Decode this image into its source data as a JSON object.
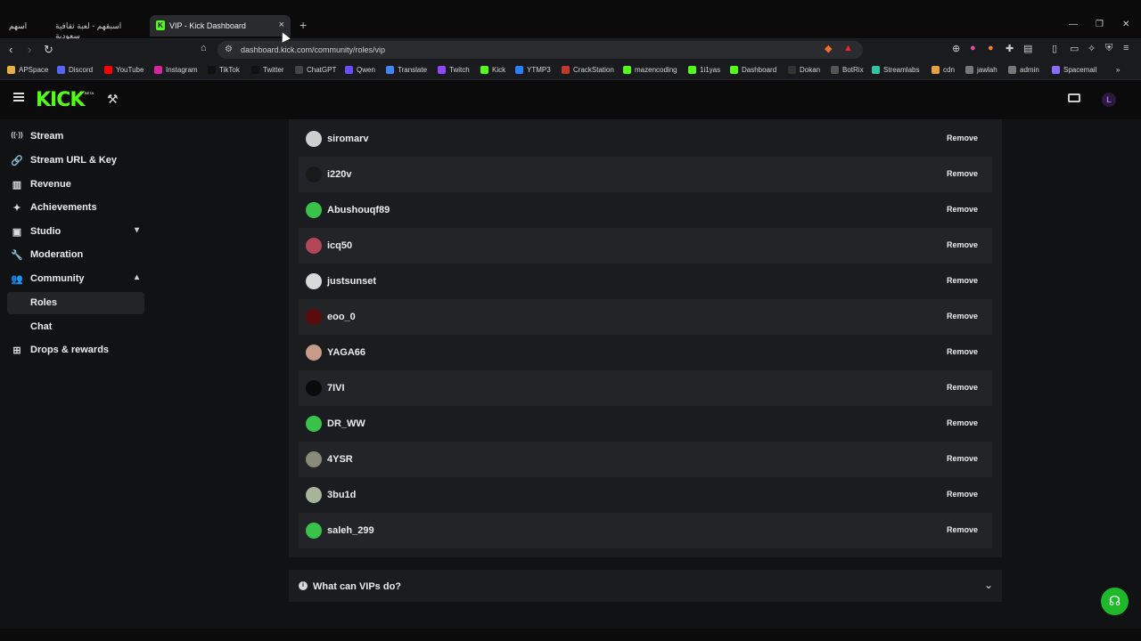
{
  "browser": {
    "tabs": [
      {
        "label": "اسبقهم - لعبة ثقافية سعودية",
        "icon_text": "اسهم"
      },
      {
        "label": "VIP - Kick Dashboard",
        "active": true
      }
    ],
    "new_tab": "+",
    "url": "dashboard.kick.com/community/roles/vip",
    "window_controls": [
      "—",
      "❐",
      "✕"
    ],
    "bookmarks": [
      {
        "label": "APSpace",
        "color": "#e8b040"
      },
      {
        "label": "Discord",
        "color": "#5865f2"
      },
      {
        "label": "YouTube",
        "color": "#ff0000"
      },
      {
        "label": "Instagram",
        "color": "#d6249f"
      },
      {
        "label": "TikTok",
        "color": "#111111"
      },
      {
        "label": "Twitter",
        "color": "#111111"
      },
      {
        "label": "ChatGPT",
        "color": "#444444"
      },
      {
        "label": "Qwen",
        "color": "#6b4cff"
      },
      {
        "label": "Translate",
        "color": "#4285f4"
      },
      {
        "label": "Twitch",
        "color": "#9146ff"
      },
      {
        "label": "Kick",
        "color": "#53fc18"
      },
      {
        "label": "YTMP3",
        "color": "#2a7fff"
      },
      {
        "label": "CrackStation",
        "color": "#c0392b"
      },
      {
        "label": "mazencoding",
        "color": "#53fc18"
      },
      {
        "label": "1i1yas",
        "color": "#53fc18"
      },
      {
        "label": "Dashboard",
        "color": "#53fc18"
      },
      {
        "label": "Dokan",
        "color": "#333333"
      },
      {
        "label": "BotRix",
        "color": "#555555"
      },
      {
        "label": "Streamlabs",
        "color": "#31c3a2"
      },
      {
        "label": "cdn",
        "color": "#e8a040"
      },
      {
        "label": "jawlah",
        "color": "#777777"
      },
      {
        "label": "admin",
        "color": "#777777"
      },
      {
        "label": "Spacemail",
        "color": "#8a6cff"
      }
    ]
  },
  "header": {
    "logo": "KICK",
    "beta": "BETA",
    "avatar_letter": "L"
  },
  "sidebar": {
    "items": [
      {
        "label": "Stream",
        "icon": "radio-icon",
        "glyph": "((·))"
      },
      {
        "label": "Stream URL & Key",
        "icon": "link-icon",
        "glyph": "🔗"
      },
      {
        "label": "Revenue",
        "icon": "chart-icon",
        "glyph": "▥"
      },
      {
        "label": "Achievements",
        "icon": "trophy-icon",
        "glyph": "✦"
      },
      {
        "label": "Studio",
        "icon": "studio-icon",
        "glyph": "▣",
        "chevron": "▾"
      },
      {
        "label": "Moderation",
        "icon": "wrench-icon",
        "glyph": "🔧"
      },
      {
        "label": "Community",
        "icon": "community-icon",
        "glyph": "👥",
        "chevron": "▴"
      },
      {
        "label": "Drops & rewards",
        "icon": "drops-icon",
        "glyph": "⊞"
      }
    ],
    "sub_items": [
      {
        "label": "Roles",
        "active": true
      },
      {
        "label": "Chat",
        "active": false
      }
    ]
  },
  "vip_list": {
    "remove_label": "Remove",
    "users": [
      {
        "name": "siromarv",
        "avatar_color": "#cfcfcf"
      },
      {
        "name": "i220v",
        "avatar_color": "#1a1a1a"
      },
      {
        "name": "Abushouqf89",
        "avatar_color": "#3ac14a"
      },
      {
        "name": "icq50",
        "avatar_color": "#b2475a"
      },
      {
        "name": "justsunset",
        "avatar_color": "#d9d9d9"
      },
      {
        "name": "eoo_0",
        "avatar_color": "#5a0c0c"
      },
      {
        "name": "YAGA66",
        "avatar_color": "#c79a8a"
      },
      {
        "name": "7IVI",
        "avatar_color": "#0a0a0a"
      },
      {
        "name": "DR_WW",
        "avatar_color": "#3ac14a"
      },
      {
        "name": "4YSR",
        "avatar_color": "#8a8a7a"
      },
      {
        "name": "3bu1d",
        "avatar_color": "#a7b59a"
      },
      {
        "name": "saleh_299",
        "avatar_color": "#3ac14a"
      }
    ]
  },
  "faq": {
    "label": "What can VIPs do?"
  }
}
